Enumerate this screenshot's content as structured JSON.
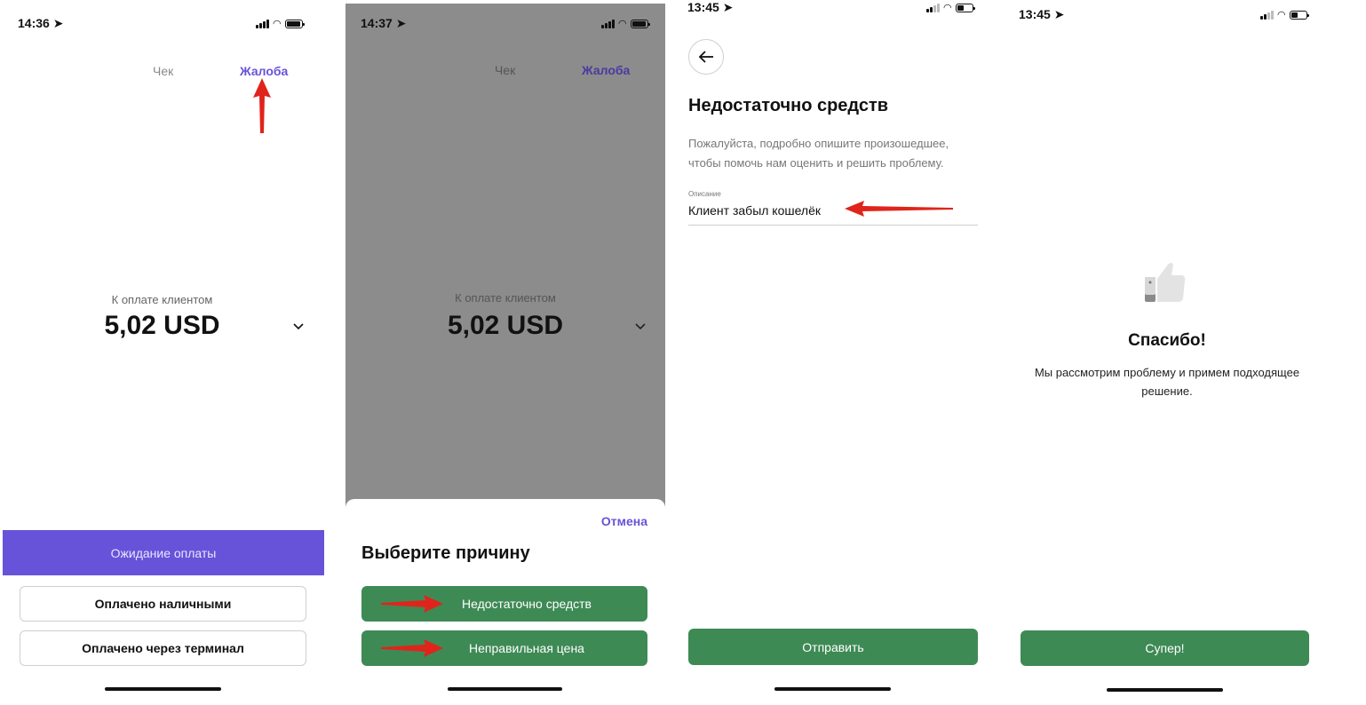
{
  "screen1": {
    "time": "14:36",
    "tabs": {
      "receipt": "Чек",
      "complaint": "Жалоба"
    },
    "amount_label": "К оплате клиентом",
    "amount": "5,02 USD",
    "waiting_label": "Ожидание оплаты",
    "paid_cash_label": "Оплачено наличными",
    "paid_terminal_label": "Оплачено через терминал"
  },
  "screen2": {
    "time": "14:37",
    "tabs": {
      "receipt": "Чек",
      "complaint": "Жалоба"
    },
    "amount_label": "К оплате клиентом",
    "amount": "5,02 USD",
    "cancel_label": "Отмена",
    "sheet_title": "Выберите причину",
    "reasons": [
      "Недостаточно средств",
      "Неправильная цена"
    ]
  },
  "screen3": {
    "time": "13:45",
    "title": "Недостаточно средств",
    "description": "Пожалуйста, подробно опишите произошедшее, чтобы помочь нам оценить и решить проблему.",
    "field_label": "Описание",
    "field_value": "Клиент забыл кошелёк",
    "submit_label": "Отправить"
  },
  "screen4": {
    "time": "13:45",
    "title": "Спасибо!",
    "text": "Мы рассмотрим проблему и примем подходящее решение.",
    "button_label": "Супер!"
  },
  "colors": {
    "accent_purple": "#6753d9",
    "button_green": "#3e8a55",
    "overlay_gray": "#8c8c8c",
    "annotation_red": "#e0241b"
  }
}
